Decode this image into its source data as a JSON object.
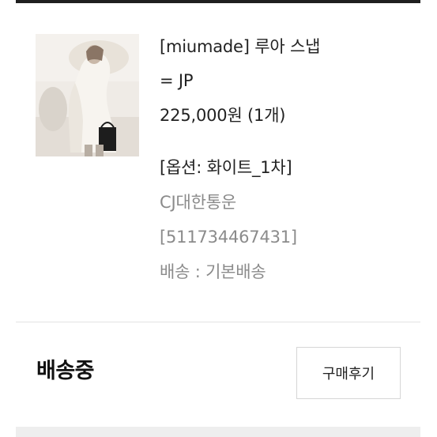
{
  "order": {
    "product_name_line1": "[miumade] 루아 스냅",
    "product_name_line2": "= JP",
    "price": "225,000원 (1개)",
    "option": "[옵션: 화이트_1차]",
    "courier": "CJ대한통운",
    "tracking_number": "[511734467431]",
    "shipping": "배송 : 기본배송"
  },
  "status": {
    "label": "배송중"
  },
  "actions": {
    "review_label": "구매후기"
  },
  "image": {
    "icon": "product-photo"
  }
}
